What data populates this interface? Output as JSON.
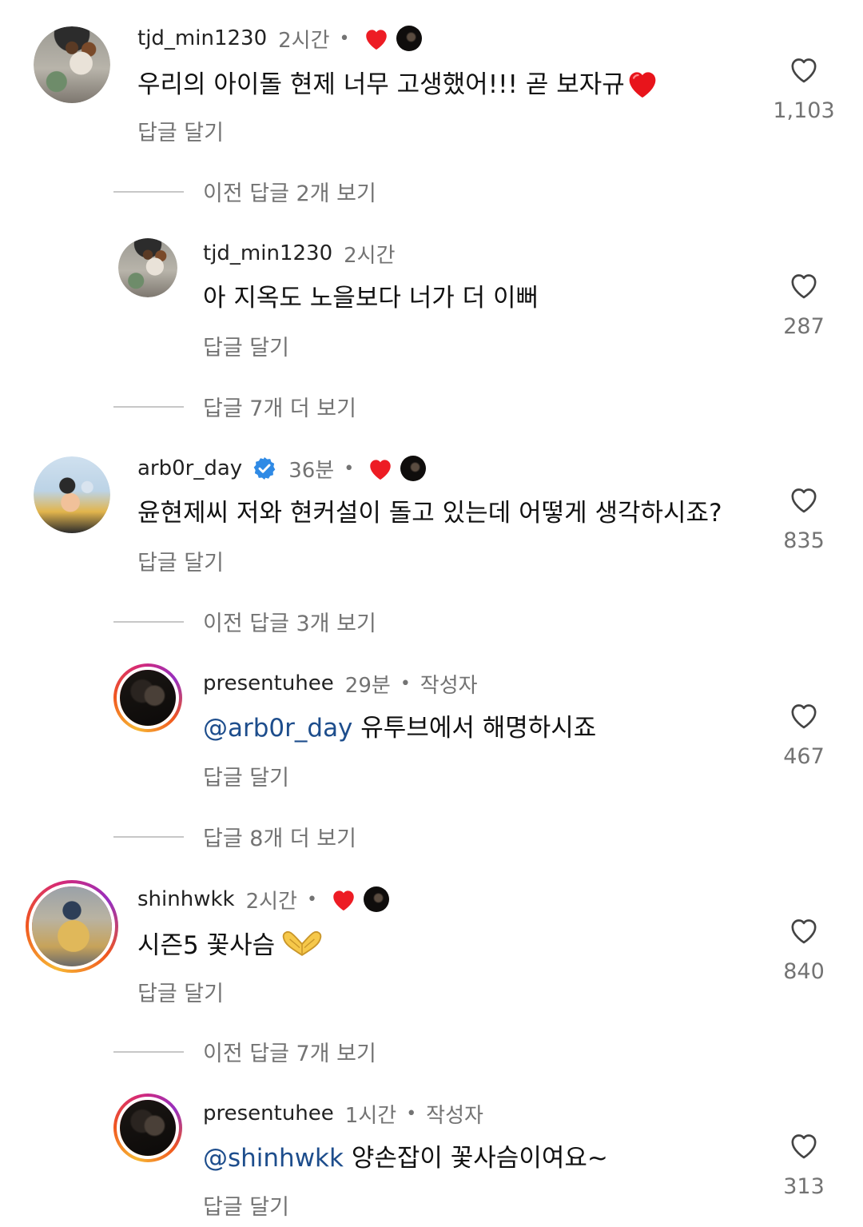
{
  "comments": [
    {
      "username": "tjd_min1230",
      "time": "2시간",
      "text": "우리의 아이돌 현제 너무 고생했어!!! 곧 보자규",
      "reply_label": "답글 달기",
      "likes": "1,103",
      "avatar_icon": "dog-photo-avatar",
      "liked_by_creator": true
    },
    {
      "username": "tjd_min1230",
      "time": "2시간",
      "text": "아 지옥도 노을보다 너가 더 이뻐",
      "reply_label": "답글 달기",
      "likes": "287",
      "avatar_icon": "dog-photo-avatar"
    },
    {
      "username": "arb0r_day",
      "time": "36분",
      "verified": true,
      "text": "윤현제씨 저와 현커설이 돌고 있는데 어떻게 생각하시죠?",
      "reply_label": "답글 달기",
      "likes": "835",
      "avatar_icon": "drinking-water-photo-avatar",
      "liked_by_creator": true
    },
    {
      "username": "presentuhee",
      "time": "29분",
      "author_label": "작성자",
      "mention": "@arb0r_day",
      "text": " 유투브에서 해명하시죠",
      "reply_label": "답글 달기",
      "likes": "467",
      "avatar_icon": "dark-photo-avatar"
    },
    {
      "username": "shinhwkk",
      "time": "2시간",
      "text": "시즌5 꽃사슴",
      "reply_label": "답글 달기",
      "likes": "840",
      "avatar_icon": "yellow-shirt-photo-avatar",
      "liked_by_creator": true
    },
    {
      "username": "presentuhee",
      "time": "1시간",
      "author_label": "작성자",
      "mention": "@shinhwkk",
      "text": " 양손잡이 꽃사슴이여요~",
      "reply_label": "답글 달기",
      "likes": "313",
      "avatar_icon": "dark-photo-avatar"
    }
  ],
  "view_more": [
    "이전 답글 2개 보기",
    "답글 7개 더 보기",
    "이전 답글 3개 보기",
    "답글 8개 더 보기",
    "이전 답글 7개 보기"
  ],
  "colors": {
    "mention": "#1d4d8c",
    "secondary_text": "#737373",
    "heart_red": "#ed1c24",
    "verified_blue": "#2f8ae5"
  }
}
